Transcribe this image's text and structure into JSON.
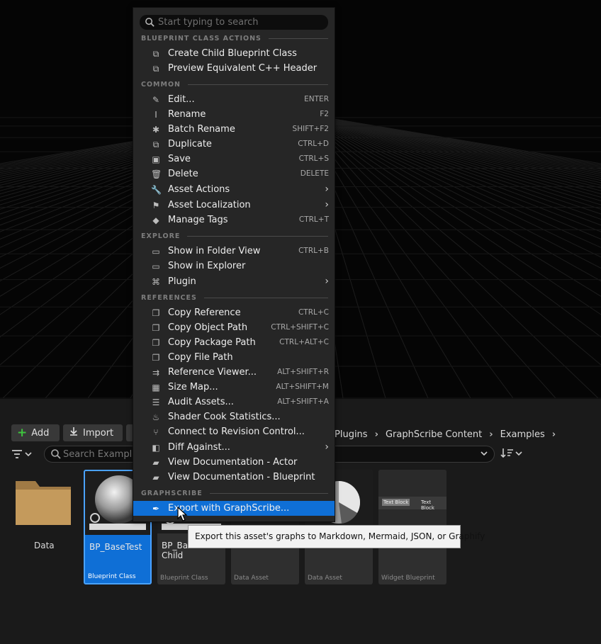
{
  "menu": {
    "search_placeholder": "Start typing to search",
    "sections": {
      "blueprint_class_actions": "BLUEPRINT CLASS ACTIONS",
      "common": "COMMON",
      "explore": "EXPLORE",
      "references": "REFERENCES",
      "graphscribe": "GRAPHSCRIBE"
    },
    "items": {
      "create_child": {
        "label": "Create Child Blueprint Class",
        "icon": "blueprint-icon"
      },
      "preview_cpp": {
        "label": "Preview Equivalent C++ Header",
        "icon": "blueprint-icon"
      },
      "edit": {
        "label": "Edit...",
        "shortcut": "ENTER",
        "icon": "pencil-icon"
      },
      "rename": {
        "label": "Rename",
        "shortcut": "F2",
        "icon": "rename-icon"
      },
      "batch_rename": {
        "label": "Batch Rename",
        "shortcut": "SHIFT+F2",
        "icon": "asterisk-icon"
      },
      "duplicate": {
        "label": "Duplicate",
        "shortcut": "CTRL+D",
        "icon": "duplicate-icon"
      },
      "save": {
        "label": "Save",
        "shortcut": "CTRL+S",
        "icon": "save-icon"
      },
      "delete": {
        "label": "Delete",
        "shortcut": "DELETE",
        "icon": "trash-icon"
      },
      "asset_actions": {
        "label": "Asset Actions",
        "icon": "wrench-icon"
      },
      "asset_localization": {
        "label": "Asset Localization",
        "icon": "flag-icon"
      },
      "manage_tags": {
        "label": "Manage Tags",
        "shortcut": "CTRL+T",
        "icon": "tag-icon"
      },
      "show_folder": {
        "label": "Show in Folder View",
        "shortcut": "CTRL+B",
        "icon": "folder-search-icon"
      },
      "show_explorer": {
        "label": "Show in Explorer",
        "icon": "folder-search-icon"
      },
      "plugin": {
        "label": "Plugin",
        "icon": "plugin-icon"
      },
      "copy_reference": {
        "label": "Copy Reference",
        "shortcut": "CTRL+C",
        "icon": "copy-icon"
      },
      "copy_object_path": {
        "label": "Copy Object Path",
        "shortcut": "CTRL+SHIFT+C",
        "icon": "copy-icon"
      },
      "copy_package_path": {
        "label": "Copy Package Path",
        "shortcut": "CTRL+ALT+C",
        "icon": "copy-icon"
      },
      "copy_file_path": {
        "label": "Copy File Path",
        "icon": "copy-icon"
      },
      "reference_viewer": {
        "label": "Reference Viewer...",
        "shortcut": "ALT+SHIFT+R",
        "icon": "reference-viewer-icon"
      },
      "size_map": {
        "label": "Size Map...",
        "shortcut": "ALT+SHIFT+M",
        "icon": "size-map-icon"
      },
      "audit_assets": {
        "label": "Audit Assets...",
        "shortcut": "ALT+SHIFT+A",
        "icon": "audit-icon"
      },
      "shader_cook": {
        "label": "Shader Cook Statistics...",
        "icon": "shader-icon"
      },
      "revision_control": {
        "label": "Connect to Revision Control...",
        "icon": "branch-icon"
      },
      "diff_against": {
        "label": "Diff Against...",
        "icon": "diff-icon"
      },
      "doc_actor": {
        "label": "View Documentation - Actor",
        "icon": "book-icon"
      },
      "doc_blueprint": {
        "label": "View Documentation - Blueprint",
        "icon": "book-icon"
      },
      "export_graphscribe": {
        "label": "Export with GraphScribe...",
        "icon": "quill-icon"
      }
    }
  },
  "tooltip": "Export this asset's graphs to Markdown, Mermaid, JSON, or Graphify",
  "toolbar": {
    "add_label": "Add",
    "import_label": "Import",
    "search_placeholder": "Search Examples"
  },
  "breadcrumb": [
    "Plugins",
    "GraphScribe Content",
    "Examples"
  ],
  "assets": {
    "folder": {
      "name": "Data"
    },
    "bp_basetest": {
      "name": "BP_BaseTest",
      "type": "Blueprint Class"
    },
    "bp_child": {
      "name": "BP_Bas",
      "name2": "Child",
      "type": "Blueprint Class"
    },
    "data_asset_1": {
      "type": "Data Asset"
    },
    "data_asset_2": {
      "type": "Data Asset"
    },
    "widget_bp": {
      "type": "Widget Blueprint",
      "text_a": "Text Block",
      "text_b": "Text Block"
    }
  },
  "colors": {
    "selection": "#0f6fd6",
    "menu_bg": "#262626",
    "add_plus": "#3ec53e"
  }
}
